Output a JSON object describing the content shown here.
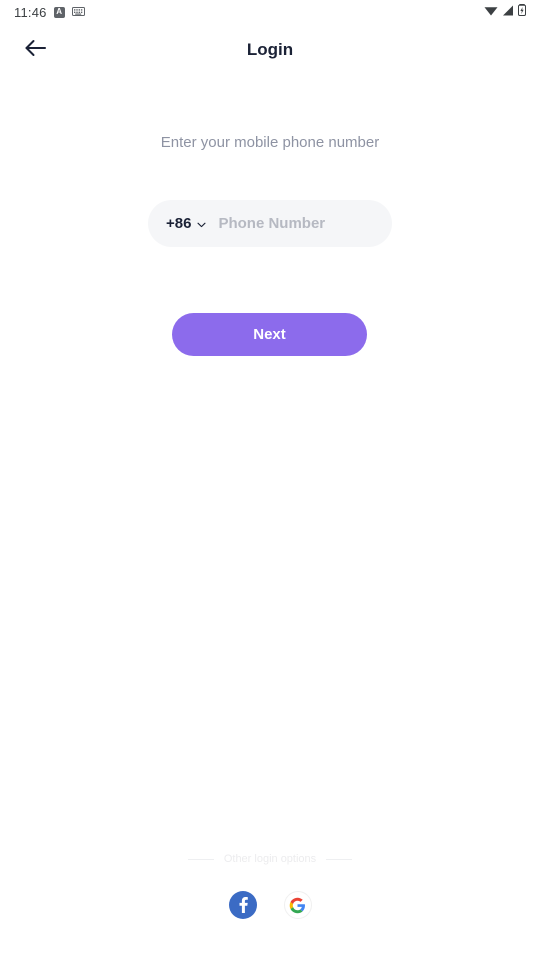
{
  "status_bar": {
    "time": "11:46",
    "left_icons": [
      {
        "name": "alphabet-badge-icon",
        "glyph": "A"
      },
      {
        "name": "keyboard-icon",
        "glyph": "keyboard"
      }
    ],
    "right_icons": [
      {
        "name": "wifi-icon",
        "glyph": "wifi"
      },
      {
        "name": "cellular-signal-icon",
        "glyph": "signal"
      },
      {
        "name": "battery-charging-icon",
        "glyph": "battery"
      }
    ]
  },
  "appbar": {
    "back_icon": "arrow-left-icon",
    "title": "Login"
  },
  "main": {
    "subtitle": "Enter your mobile phone number",
    "phone_field": {
      "country_code": "+86",
      "dropdown_icon": "chevron-down-icon",
      "placeholder": "Phone Number",
      "value": ""
    },
    "next_label": "Next"
  },
  "footer": {
    "other_options_label": "Other login options",
    "socials": [
      {
        "name": "facebook-login-button",
        "label": "f"
      },
      {
        "name": "google-login-button",
        "label": "G"
      }
    ]
  },
  "colors": {
    "accent_purple": "#8c6bec",
    "title_navy": "#1b2236",
    "subtitle_gray": "#8e93a3",
    "field_bg": "#f5f6f8",
    "placeholder_gray": "#b6b9c2",
    "facebook_blue": "#3b6bc4",
    "divider_gray": "#eeeff1"
  }
}
